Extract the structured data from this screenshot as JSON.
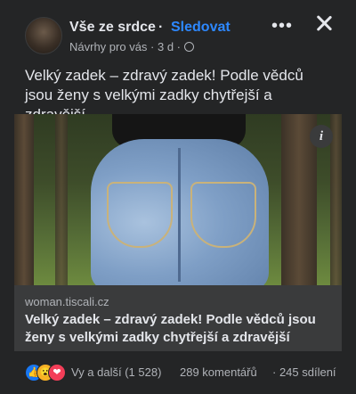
{
  "post": {
    "page_name": "Vše ze srdce",
    "separator": "·",
    "follow_label": "Sledovat",
    "meta_text": "Návrhy pro vás · 3 d ·",
    "more_label": "•••",
    "text": "Velký zadek – zdravý zadek! Podle vědců jsou ženy s velkými zadky chytřejší a zdravější"
  },
  "image": {
    "info_label": "i"
  },
  "link_preview": {
    "domain": "woman.tiscali.cz",
    "title": "Velký zadek – zdravý zadek! Podle vědců jsou ženy s velkými zadky chytřejší a zdravější"
  },
  "engagement": {
    "reactions_text": "Vy a další (1 528)",
    "comments_text": "289 komentářů",
    "shares_text": "· 245 sdílení",
    "reaction_icons": [
      "like-icon",
      "wow-icon",
      "love-icon"
    ],
    "reaction_glyphs": {
      "like": "👍",
      "wow": "😮",
      "love": "❤"
    }
  },
  "colors": {
    "background": "#242526",
    "accent": "#2d88ff",
    "text": "#e4e6eb",
    "secondary_text": "#b0b3b8"
  }
}
